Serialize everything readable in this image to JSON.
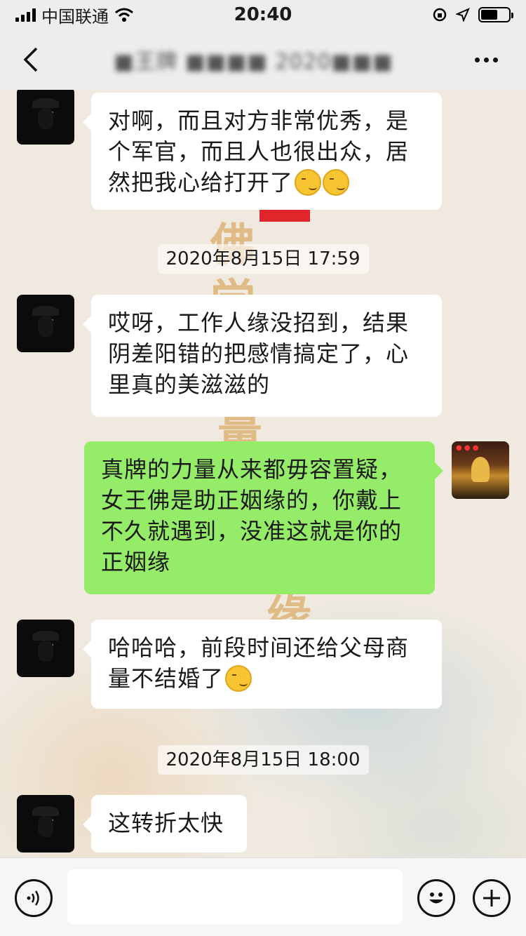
{
  "status_bar": {
    "carrier": "中国联通",
    "time": "20:40"
  },
  "nav": {
    "title": "■王牌 ■■■■ 2020■■■"
  },
  "messages": [
    {
      "type": "text",
      "from": "other",
      "text": "对啊，而且对方非常优秀，是个军官，而且人也很出众，居然把我心给打开了",
      "emoji_count": 2
    },
    {
      "type": "timestamp",
      "text": "2020年8月15日 17:59"
    },
    {
      "type": "text",
      "from": "other",
      "text": "哎呀，工作人缘没招到，结果阴差阳错的把感情搞定了，心里真的美滋滋的"
    },
    {
      "type": "text",
      "from": "self",
      "text": "真牌的力量从来都毋容置疑，女王佛是助正姻缘的，你戴上不久就遇到，没准这就是你的正姻缘"
    },
    {
      "type": "text",
      "from": "other",
      "text": "哈哈哈，前段时间还给父母商量不结婚了",
      "emoji_count": 1
    },
    {
      "type": "timestamp",
      "text": "2020年8月15日 18:00"
    },
    {
      "type": "text",
      "from": "other",
      "text": "这转折太快"
    }
  ],
  "colors": {
    "bubble_in": "#ffffff",
    "bubble_out": "#95ec69",
    "bar_bg": "#ededed"
  }
}
